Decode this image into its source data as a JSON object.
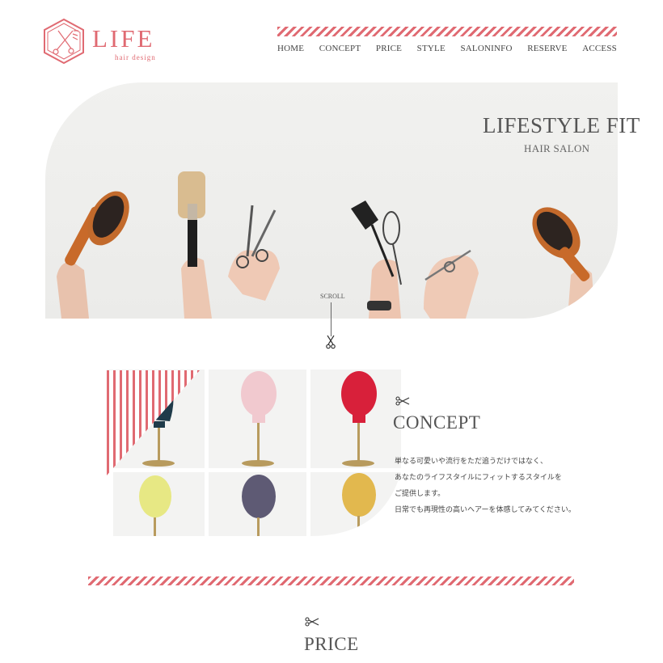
{
  "brand": {
    "title": "LIFE",
    "subtitle": "hair design",
    "accent_color": "#e06a72",
    "logo_icon": "scissors-hexagon-icon"
  },
  "nav": {
    "items": [
      "HOME",
      "CONCEPT",
      "PRICE",
      "STYLE",
      "SALONINFO",
      "RESERVE",
      "ACCESS"
    ]
  },
  "hero": {
    "title": "LIFESTYLE FIT",
    "subtitle": "HAIR SALON",
    "scroll_label": "SCROLL",
    "scroll_icon": "scissors-icon"
  },
  "concept": {
    "icon": "scissors-icon",
    "title": "CONCEPT",
    "lines": [
      "単なる可愛いや流行をただ追うだけではなく、",
      "あなたのライフスタイルにフィットするスタイルを",
      "ご提供します。",
      "日常でも再現性の高いヘアーを体感してみてください。"
    ],
    "mannequin_colors": [
      "#1f3b4a",
      "#f1c9cf",
      "#d8203a",
      "#e7e884",
      "#5e5a74",
      "#e2b84e"
    ]
  },
  "price": {
    "icon": "scissors-icon",
    "title": "PRICE"
  }
}
